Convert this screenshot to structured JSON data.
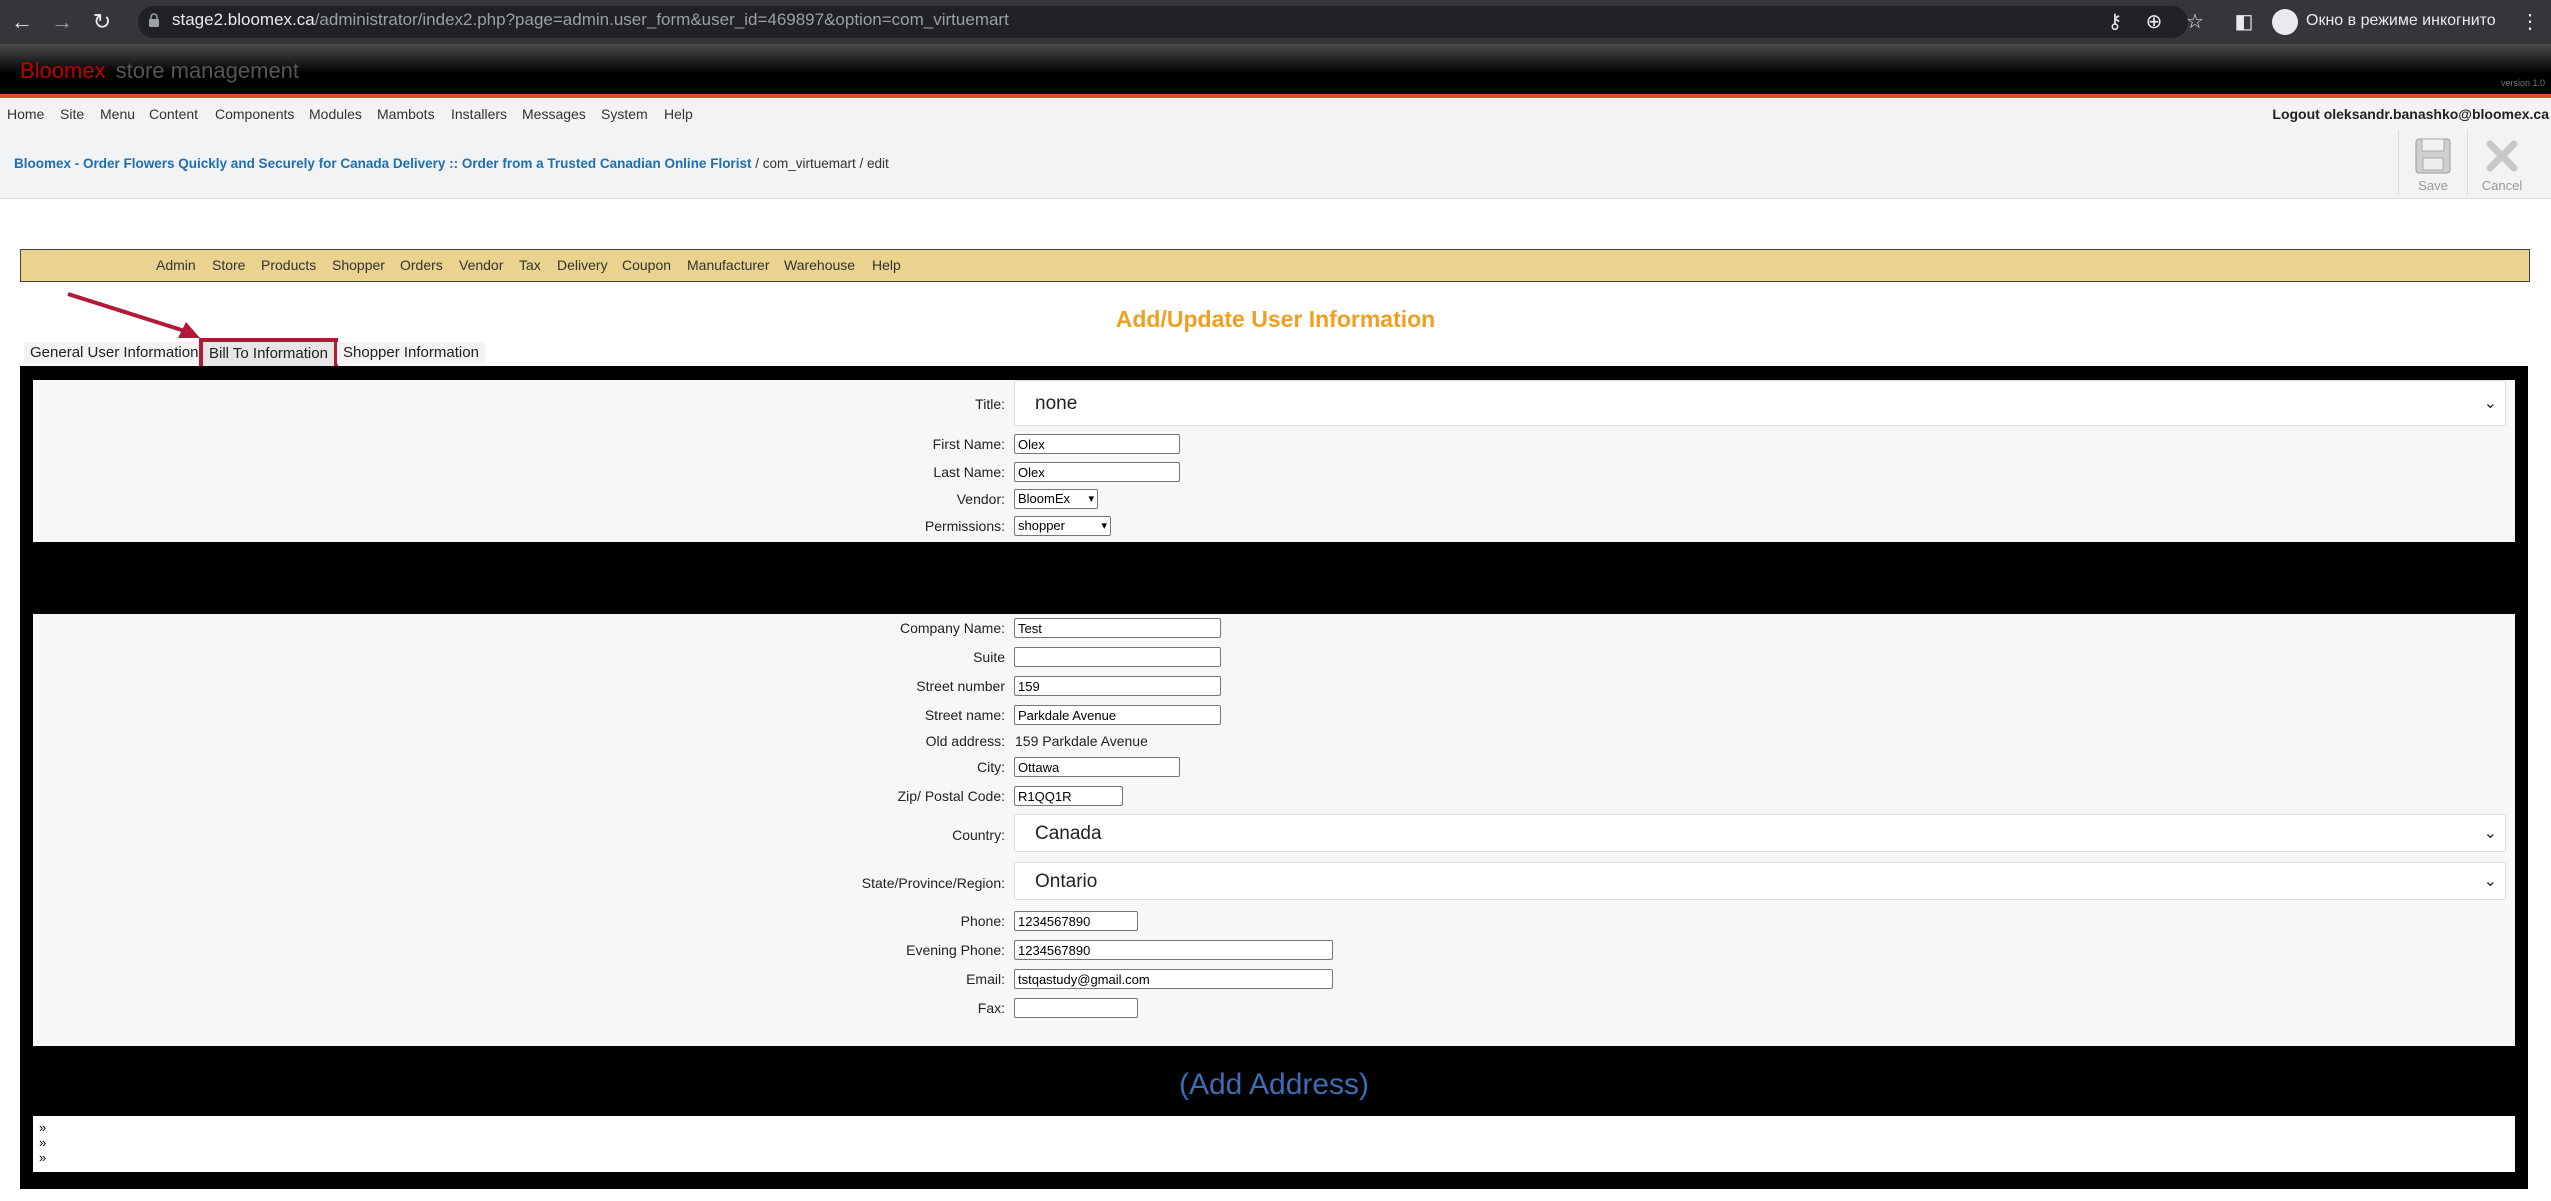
{
  "browser": {
    "url_host": "stage2.bloomex.ca",
    "url_path": "/administrator/index2.php?page=admin.user_form&user_id=469897&option=com_virtuemart",
    "incognito_label": "Окно в режиме инкогнито"
  },
  "header": {
    "brand_red": "Bloomex",
    "brand_grey": "store management",
    "version": "version 1.0"
  },
  "top_menu": {
    "items": [
      "Home",
      "Site",
      "Menu",
      "Content",
      "Components",
      "Modules",
      "Mambots",
      "Installers",
      "Messages",
      "System",
      "Help"
    ],
    "logout": "Logout oleksandr.banashko@bloomex.ca"
  },
  "breadcrumb": {
    "link": "Bloomex - Order Flowers Quickly and Securely for Canada Delivery :: Order from a Trusted Canadian Online Florist",
    "rest": " / com_virtuemart / edit"
  },
  "toolbar": {
    "save_label": "Save",
    "cancel_label": "Cancel"
  },
  "sub_menu": {
    "items": [
      "Admin",
      "Store",
      "Products",
      "Shopper",
      "Orders",
      "Vendor",
      "Tax",
      "Delivery",
      "Coupon",
      "Manufacturer",
      "Warehouse",
      "Help"
    ]
  },
  "page_title": "Add/Update User Information",
  "tabs": [
    "General User Information",
    "Bill To Information",
    "Shopper Information"
  ],
  "user": {
    "title_label": "Title:",
    "title_value": "none",
    "first_name_label": "First Name:",
    "first_name_value": "Olex",
    "last_name_label": "Last Name:",
    "last_name_value": "Olex",
    "vendor_label": "Vendor:",
    "vendor_value": "BloomEx",
    "permissions_label": "Permissions:",
    "permissions_value": "shopper"
  },
  "address": {
    "company_label": "Company Name:",
    "company_value": "Test",
    "suite_label": "Suite",
    "suite_value": "",
    "street_number_label": "Street number",
    "street_number_value": "159",
    "street_name_label": "Street name:",
    "street_name_value": "Parkdale Avenue",
    "old_address_label": "Old address:",
    "old_address_value": "159 Parkdale Avenue",
    "city_label": "City:",
    "city_value": "Ottawa",
    "zip_label": "Zip/ Postal Code:",
    "zip_value": "R1QQ1R",
    "country_label": "Country:",
    "country_value": "Canada",
    "state_label": "State/Province/Region:",
    "state_value": "Ontario",
    "phone_label": "Phone:",
    "phone_value": "1234567890",
    "evening_phone_label": "Evening Phone:",
    "evening_phone_value": "1234567890",
    "email_label": "Email:",
    "email_value": "tstqastudy@gmail.com",
    "fax_label": "Fax:",
    "fax_value": ""
  },
  "add_address": "(Add Address)",
  "raquo": "»",
  "colors": {
    "accent_orange": "#f0a020",
    "link_blue": "#1e6fb0",
    "header_red": "#c00000",
    "submenu_bg": "#e9d38e",
    "highlight": "#b01938"
  }
}
